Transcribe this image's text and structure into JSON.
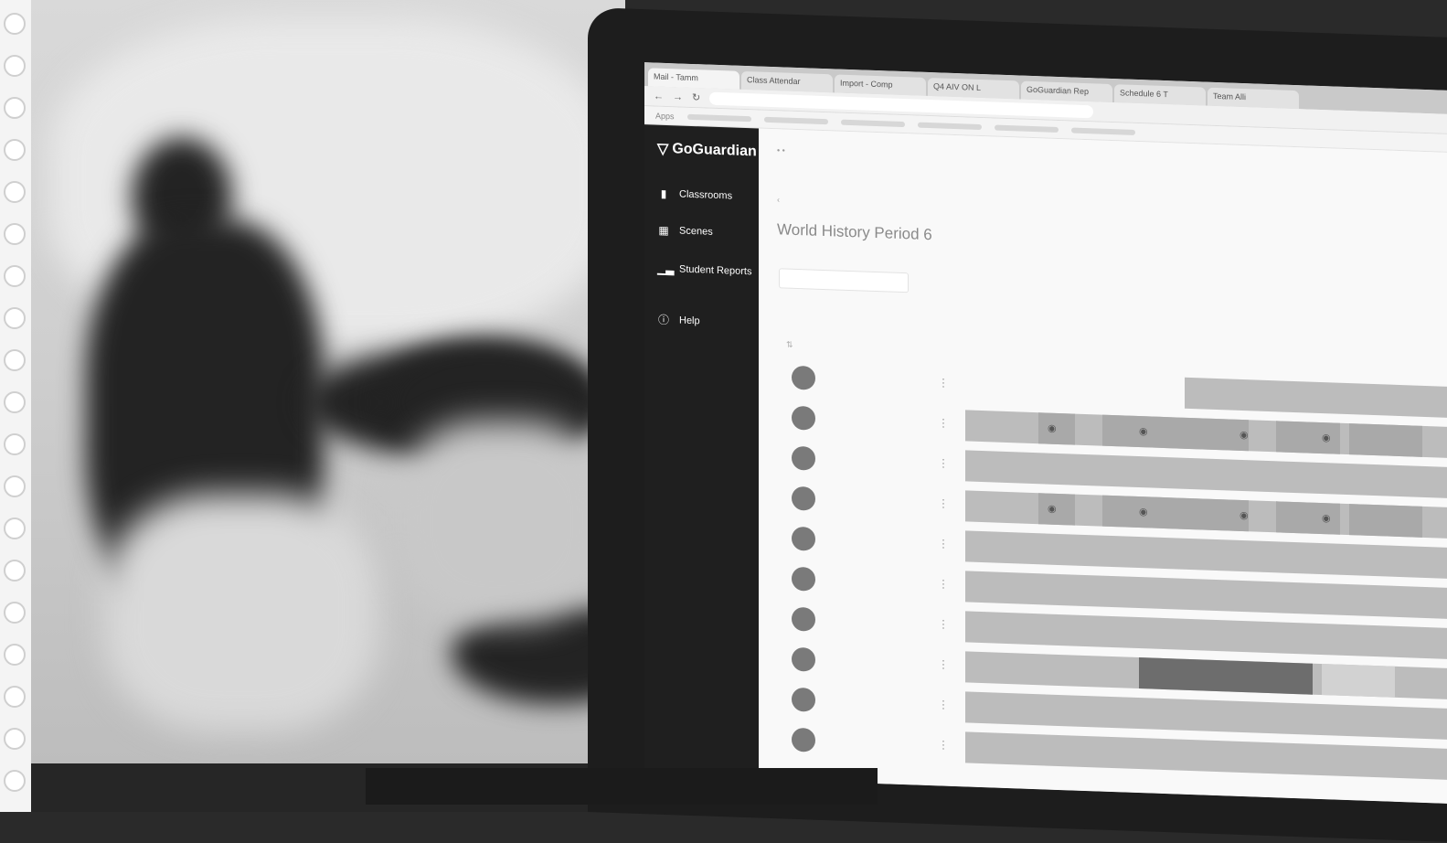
{
  "browser": {
    "tabs": [
      "Mail - Tamm",
      "Class Attendar",
      "Import - Comp",
      "Q4 AIV ON L",
      "GoGuardian Rep",
      "Schedule 6 T",
      "Team Alli"
    ],
    "bookmarks_label": "Apps"
  },
  "app": {
    "logo_text": "GoGuardian",
    "nav": [
      {
        "label": "Classrooms",
        "icon": "book-icon"
      },
      {
        "label": "Scenes",
        "icon": "calendar-icon"
      },
      {
        "label": "Student Reports",
        "icon": "bar-chart-icon"
      },
      {
        "label": "Help",
        "icon": "question-icon"
      }
    ]
  },
  "page": {
    "title": "World History Period 6"
  },
  "students": [
    {
      "id": "s1",
      "bar": "partial"
    },
    {
      "id": "s2",
      "bar": "segments"
    },
    {
      "id": "s3",
      "bar": "full"
    },
    {
      "id": "s4",
      "bar": "segments"
    },
    {
      "id": "s5",
      "bar": "full"
    },
    {
      "id": "s6",
      "bar": "full"
    },
    {
      "id": "s7",
      "bar": "full"
    },
    {
      "id": "s8",
      "bar": "highlight"
    },
    {
      "id": "s9",
      "bar": "full"
    },
    {
      "id": "s10",
      "bar": "full"
    }
  ]
}
